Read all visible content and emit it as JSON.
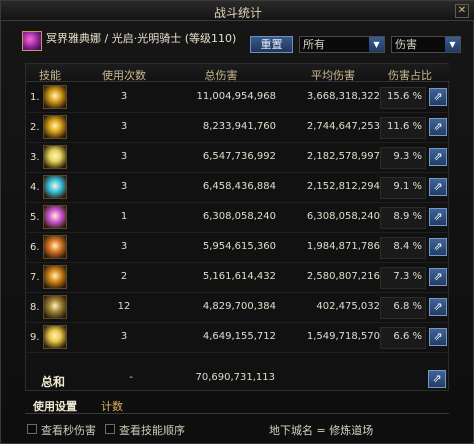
{
  "window": {
    "title": "战斗统计",
    "close_label": "✕"
  },
  "character": {
    "name": "冥界雅典娜 / 光启·光明骑士 (等级110)"
  },
  "controls": {
    "reset_label": "重置",
    "filter_select": "所有",
    "type_select": "伤害"
  },
  "table": {
    "headers": {
      "skill": "技能",
      "uses": "使用次数",
      "total": "总伤害",
      "avg": "平均伤害",
      "share": "伤害占比"
    },
    "rows": [
      {
        "rank": "1.",
        "uses": "3",
        "total": "11,004,954,968",
        "avg": "3,668,318,322",
        "pct": "15.6 %",
        "icon_color": "#d9a21e"
      },
      {
        "rank": "2.",
        "uses": "3",
        "total": "8,233,941,760",
        "avg": "2,744,647,253",
        "pct": "11.6 %",
        "icon_color": "#e0a51a"
      },
      {
        "rank": "3.",
        "uses": "3",
        "total": "6,547,736,992",
        "avg": "2,182,578,997",
        "pct": "9.3 %",
        "icon_color": "#e4d25a"
      },
      {
        "rank": "4.",
        "uses": "3",
        "total": "6,458,436,884",
        "avg": "2,152,812,294",
        "pct": "9.1 %",
        "icon_color": "#3cc7e8"
      },
      {
        "rank": "5.",
        "uses": "1",
        "total": "6,308,058,240",
        "avg": "6,308,058,240",
        "pct": "8.9 %",
        "icon_color": "#d65fe0"
      },
      {
        "rank": "6.",
        "uses": "3",
        "total": "5,954,615,360",
        "avg": "1,984,871,786",
        "pct": "8.4 %",
        "icon_color": "#e07a2a"
      },
      {
        "rank": "7.",
        "uses": "2",
        "total": "5,161,614,432",
        "avg": "2,580,807,216",
        "pct": "7.3 %",
        "icon_color": "#d98b1e"
      },
      {
        "rank": "8.",
        "uses": "12",
        "total": "4,829,700,384",
        "avg": "402,475,032",
        "pct": "6.8 %",
        "icon_color": "#a58a3a"
      },
      {
        "rank": "9.",
        "uses": "3",
        "total": "4,649,155,712",
        "avg": "1,549,718,570",
        "pct": "6.6 %",
        "icon_color": "#e8c84a"
      }
    ],
    "total": {
      "label": "总和",
      "uses": "-",
      "sum": "70,690,731,113"
    },
    "share_icon": "share-arrow-icon"
  },
  "tabs": {
    "settings": "使用设置",
    "timer": "计数"
  },
  "footer": {
    "check_dps": "查看秒伤害",
    "check_order": "查看技能顺序",
    "dungeon": "地下城名 = 修炼道场"
  }
}
